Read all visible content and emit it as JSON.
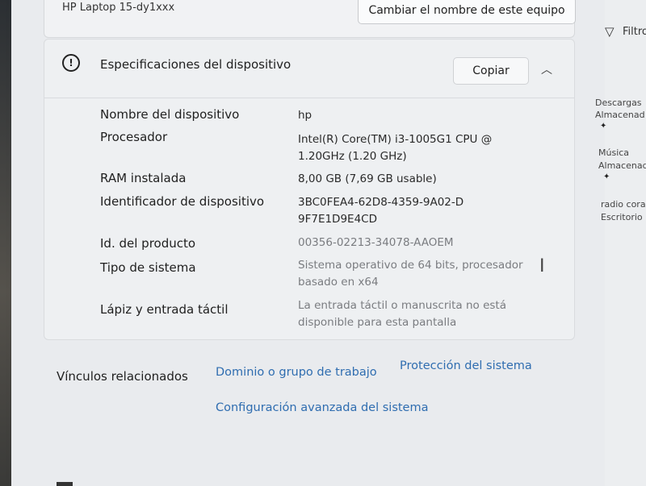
{
  "window": {
    "device_name_top": "HP Laptop 15-dy1xxx",
    "rename_button": "Cambiar el nombre de este equipo"
  },
  "specs": {
    "title": "Especificaciones del dispositivo",
    "copy_button": "Copiar",
    "rows": [
      {
        "label": "Nombre del dispositivo",
        "value": "hp"
      },
      {
        "label": "Procesador",
        "value": "Intel(R) Core(TM) i3-1005G1 CPU @ 1.20GHz (1.20 GHz)"
      },
      {
        "label": "RAM instalada",
        "value": "8,00 GB (7,69 GB usable)"
      },
      {
        "label": "Identificador de dispositivo",
        "value": "3BC0FEA4-62D8-4359-9A02-D9F7E1D9E4CD"
      },
      {
        "label": "Id. del producto",
        "value": "00356-02213-34078-AAOEM"
      },
      {
        "label": "Tipo de sistema",
        "value": "Sistema operativo de 64 bits, procesador basado en x64"
      },
      {
        "label": "Lápiz y entrada táctil",
        "value": "La entrada táctil o manuscrita no está disponible para esta pantalla"
      }
    ]
  },
  "related": {
    "label": "Vínculos relacionados",
    "links": [
      "Dominio o grupo de trabajo",
      "Protección del sistema",
      "Configuración avanzada del sistema"
    ]
  },
  "right_pane": {
    "filter": "Filtro",
    "items": [
      {
        "title": "Descargas",
        "subtitle": "Almacenad"
      },
      {
        "title": "Música",
        "subtitle": "Almacenad"
      },
      {
        "title": "radio cora",
        "subtitle": "Escritorio"
      }
    ]
  },
  "icons": [
    "info-icon",
    "chevron-up-icon",
    "filter-icon",
    "pin-icon",
    "text-cursor-icon"
  ]
}
